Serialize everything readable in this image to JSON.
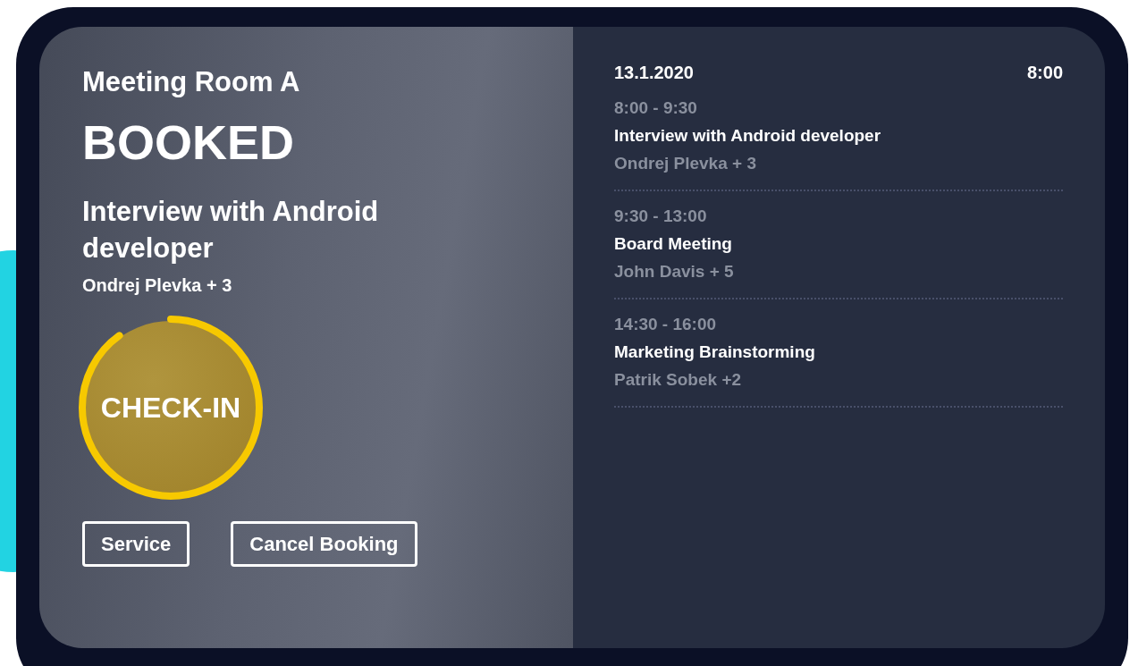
{
  "room": {
    "name": "Meeting Room A",
    "status": "BOOKED",
    "meeting_title": "Interview with Android developer",
    "organizer": "Ondrej Plevka + 3"
  },
  "check_in": {
    "label": "CHECK-IN",
    "level": 0.9
  },
  "buttons": [
    "Service",
    "Cancel Booking"
  ],
  "schedule": {
    "date": "13.1.2020",
    "time": "8:00",
    "events": [
      {
        "time": "8:00 - 9:30",
        "title": "Interview with Android developer",
        "attendees": "Ondrej Plevka + 3"
      },
      {
        "time": "9:30 - 13:00",
        "title": "Board Meeting",
        "attendees": "John Davis + 5"
      },
      {
        "time": "14:30 - 16:00",
        "title": "Marketing Brainstorming",
        "attendees": "Patrik Sobek +2"
      }
    ]
  }
}
